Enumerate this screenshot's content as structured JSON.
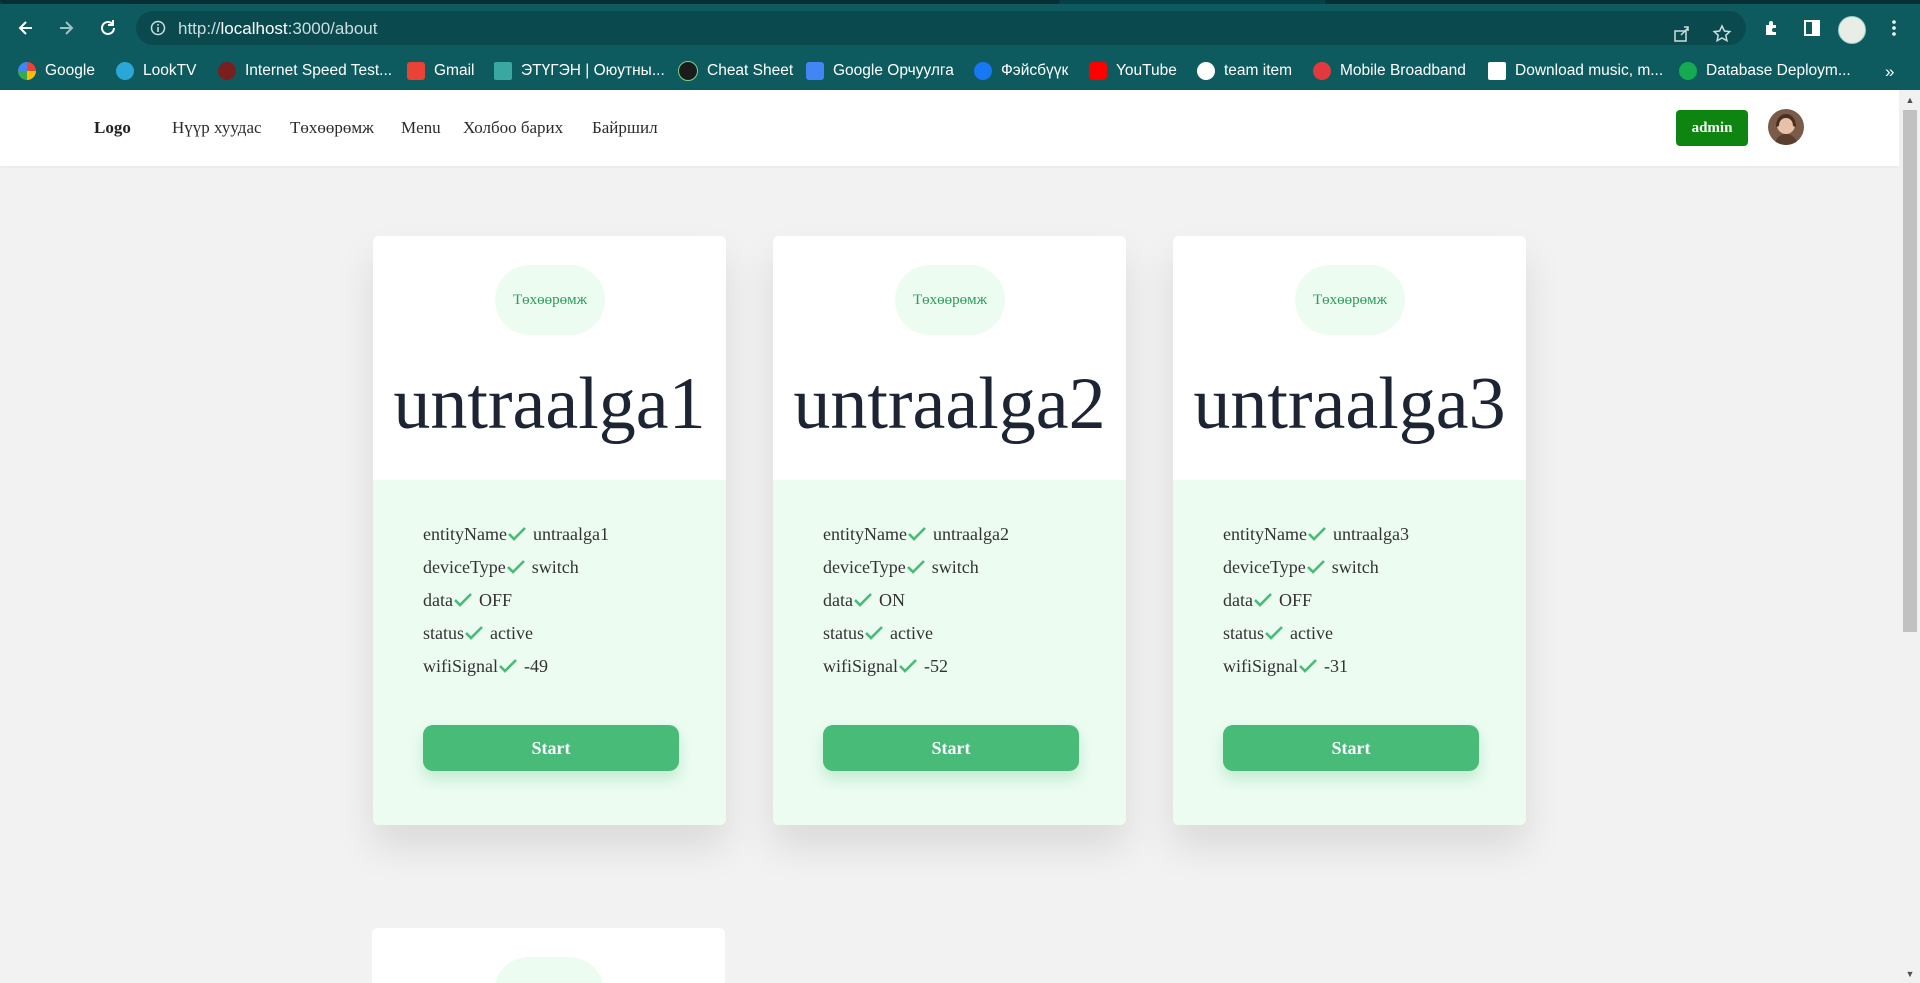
{
  "browser": {
    "url_prefix": "http://",
    "url_host": "localhost",
    "url_rest": ":3000/about",
    "bookmarks": [
      {
        "label": "Google",
        "icon": "google-icon",
        "color": "#ffffff"
      },
      {
        "label": "LookTV",
        "icon": "looktv-icon",
        "color": "#2aa7d6"
      },
      {
        "label": "Internet Speed Test...",
        "icon": "speedtest-icon",
        "color": "#c0392b"
      },
      {
        "label": "Gmail",
        "icon": "gmail-icon",
        "color": "#ea4335"
      },
      {
        "label": "ЭТҮГЭН | Оюутны...",
        "icon": "etugen-icon",
        "color": "#3aa7a0"
      },
      {
        "label": "Cheat Sheet",
        "icon": "cheatsheet-icon",
        "color": "#1b1b1b"
      },
      {
        "label": "Google Орчуулга",
        "icon": "google-translate-icon",
        "color": "#4285f4"
      },
      {
        "label": "Фэйсбүүк",
        "icon": "facebook-icon",
        "color": "#1877f2"
      },
      {
        "label": "YouTube",
        "icon": "youtube-icon",
        "color": "#ff0000"
      },
      {
        "label": "team item",
        "icon": "globe-icon",
        "color": "#ffffff"
      },
      {
        "label": "Mobile Broadband",
        "icon": "huawei-icon",
        "color": "#e03a3e"
      },
      {
        "label": "Download music, m...",
        "icon": "download-icon",
        "color": "#ffffff"
      },
      {
        "label": "Database Deploym...",
        "icon": "mongodb-icon",
        "color": "#13aa52"
      }
    ],
    "more": "»"
  },
  "header": {
    "logo": "Logo",
    "nav": [
      "Нүүр хуудас",
      "Төхөөрөмж",
      "Menu",
      "Холбоо барих",
      "Байршил"
    ],
    "admin_label": "admin"
  },
  "cards": [
    {
      "badge": "Төхөөрөмж",
      "title": "untraalga1",
      "fields": [
        {
          "key": "entityName",
          "value": "untraalga1"
        },
        {
          "key": "deviceType",
          "value": "switch"
        },
        {
          "key": "data",
          "value": "OFF"
        },
        {
          "key": "status",
          "value": "active"
        },
        {
          "key": "wifiSignal",
          "value": "-49"
        }
      ],
      "button": "Start"
    },
    {
      "badge": "Төхөөрөмж",
      "title": "untraalga2",
      "fields": [
        {
          "key": "entityName",
          "value": "untraalga2"
        },
        {
          "key": "deviceType",
          "value": "switch"
        },
        {
          "key": "data",
          "value": "ON"
        },
        {
          "key": "status",
          "value": "active"
        },
        {
          "key": "wifiSignal",
          "value": "-52"
        }
      ],
      "button": "Start"
    },
    {
      "badge": "Төхөөрөмж",
      "title": "untraalga3",
      "fields": [
        {
          "key": "entityName",
          "value": "untraalga3"
        },
        {
          "key": "deviceType",
          "value": "switch"
        },
        {
          "key": "data",
          "value": "OFF"
        },
        {
          "key": "status",
          "value": "active"
        },
        {
          "key": "wifiSignal",
          "value": "-31"
        }
      ],
      "button": "Start"
    }
  ],
  "colors": {
    "accent_green": "#48bb78",
    "admin_green": "#0d8510",
    "card_tint": "#ecfcf1",
    "chrome_teal": "#0d5b5f"
  }
}
